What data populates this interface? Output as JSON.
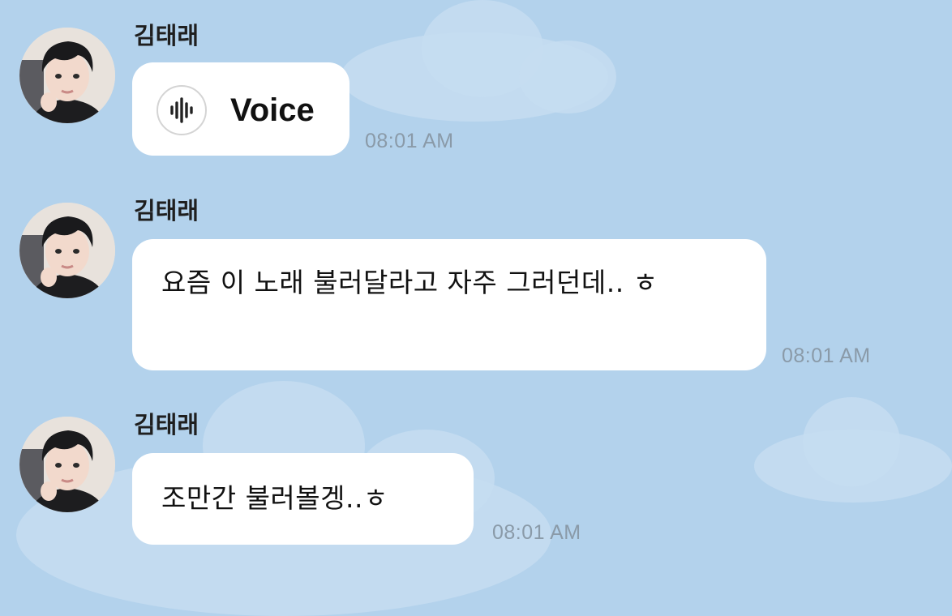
{
  "background_color": "#b3d2ec",
  "messages": [
    {
      "sender": "김태래",
      "type": "voice",
      "voice_label": "Voice",
      "voice_icon": "audio-wave-icon",
      "time": "08:01 AM"
    },
    {
      "sender": "김태래",
      "type": "text",
      "text": "요즘 이 노래 불러달라고 자주 그러던데.. ㅎ",
      "time": "08:01 AM"
    },
    {
      "sender": "김태래",
      "type": "text",
      "text": "조만간 불러볼겡..ㅎ",
      "time": "08:01 AM"
    }
  ]
}
